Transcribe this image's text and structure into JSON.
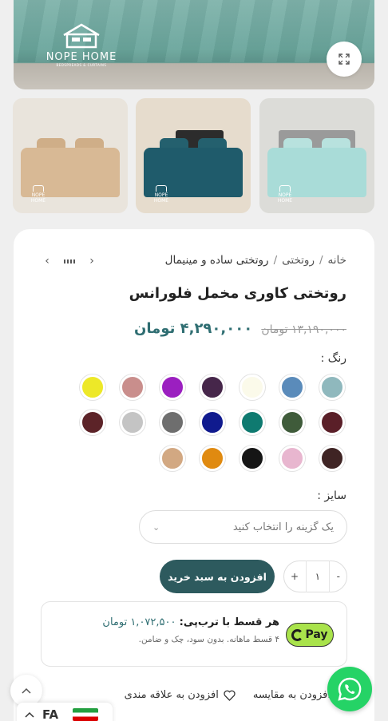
{
  "hero": {
    "logo_brand": "NOPE HOME",
    "logo_tagline": "BEDSPREADS & CURTAINS",
    "expand_icon": "expand-icon"
  },
  "thumbnails": [
    {
      "logo": "NOPE HOME",
      "colors": {
        "wall": "#e9e4dc",
        "bed": "#d8b995",
        "pillow": "#cfae88"
      }
    },
    {
      "logo": "NOPE HOME",
      "colors": {
        "wall": "#e6dccd",
        "bed": "#1f5b6b",
        "pillow": "#24606e"
      }
    },
    {
      "logo": "NOPE HOME",
      "colors": {
        "wall": "#dcdcd8",
        "bed": "#a9dcd8",
        "pillow": "#b8e2de"
      }
    }
  ],
  "breadcrumb": {
    "home": "خانه",
    "category": "روتختی",
    "subcategory": "روتختی ساده و مینیمال",
    "separator": "/"
  },
  "product": {
    "title": "روتختی کاوری مخمل فلورانس",
    "old_price": "۱۳,۱۹۰,۰۰۰ تومان",
    "new_price": "۴,۲۹۰,۰۰۰ تومان"
  },
  "color_label": "رنگ :",
  "swatches": [
    [
      "#8fb8bd",
      "#5a8bba",
      "#fbfaea",
      "#46264a",
      "#9b1fc0",
      "#c98e8c",
      "#ede828"
    ],
    [
      "#5a1f28",
      "#3f5b3a",
      "#0f7a70",
      "#101a8e",
      "#6e6e6e",
      "#c4c4c4",
      "#5c2328"
    ],
    [
      "#3f2424",
      "#e8b6cf",
      "#151515",
      "#e08a10",
      "#d2a882"
    ]
  ],
  "size_label": "سایز :",
  "size_select": {
    "placeholder": "یک گزینه را انتخاب کنید"
  },
  "quantity": {
    "minus": "-",
    "value": "۱",
    "plus": "+"
  },
  "add_to_cart": "افزودن به سبد خرید",
  "installment": {
    "title_prefix": "هر قسط با ترب‌پی:",
    "amount": "۱,۰۷۲,۵۰۰ تومان",
    "subtitle": "۴ قسط ماهانه. بدون سود، چک و ضامن.",
    "badge": "Pay"
  },
  "actions": {
    "compare": "افزودن به مقایسه",
    "wishlist": "افزودن به علاقه مندی"
  },
  "language": {
    "code": "FA"
  }
}
